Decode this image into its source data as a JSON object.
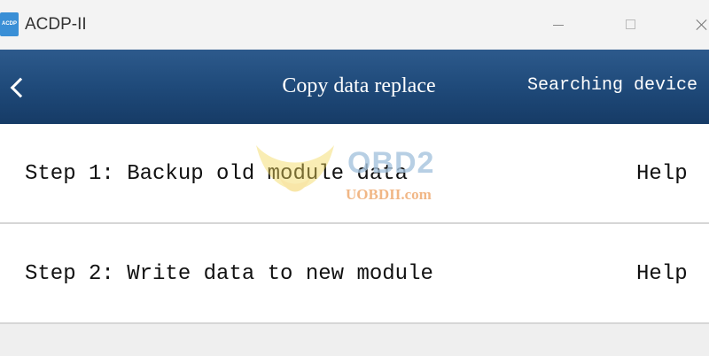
{
  "window": {
    "app_title": "ACDP-II",
    "logo_text": "ACDP"
  },
  "header": {
    "title": "Copy data replace",
    "status": "Searching device"
  },
  "steps": [
    {
      "label": "Step 1: Backup old module data",
      "help": "Help"
    },
    {
      "label": "Step 2: Write data to new module",
      "help": "Help"
    }
  ],
  "watermark": {
    "text": "OBD2",
    "subtext": "UOBDII.com"
  },
  "colors": {
    "header_top": "#2d5a8c",
    "header_bottom": "#163b66",
    "logo_blue": "#3a8fd6",
    "divider": "#d6d6d6"
  }
}
